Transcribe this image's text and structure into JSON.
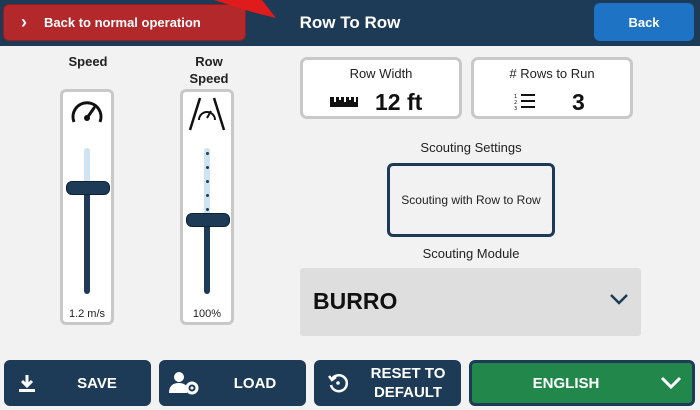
{
  "header": {
    "back_normal_label": "Back to normal operation",
    "title": "Row To Row",
    "back_label": "Back"
  },
  "speed_slider": {
    "label": "Speed",
    "value_text": "1.2 m/s",
    "level": 0.75,
    "icon": "gauge-icon"
  },
  "row_speed_slider": {
    "label": "Row Speed",
    "value_text": "100%",
    "level": 0.5,
    "icon": "row-gauge-icon"
  },
  "row_width": {
    "label": "Row Width",
    "value": "12 ft",
    "icon": "ruler-icon"
  },
  "rows_to_run": {
    "label": "# Rows to Run",
    "value": "3",
    "icon": "numbered-list-icon"
  },
  "scouting": {
    "settings_label": "Scouting Settings",
    "button_label": "Scouting with Row to Row",
    "module_label": "Scouting Module",
    "module_value": "BURRO"
  },
  "bottom": {
    "save": "SAVE",
    "load": "LOAD",
    "reset": "RESET TO DEFAULT",
    "language": "ENGLISH"
  },
  "colors": {
    "navy": "#1d3b57",
    "danger": "#b3282a",
    "primary": "#1f73c4",
    "success": "#22874a"
  }
}
